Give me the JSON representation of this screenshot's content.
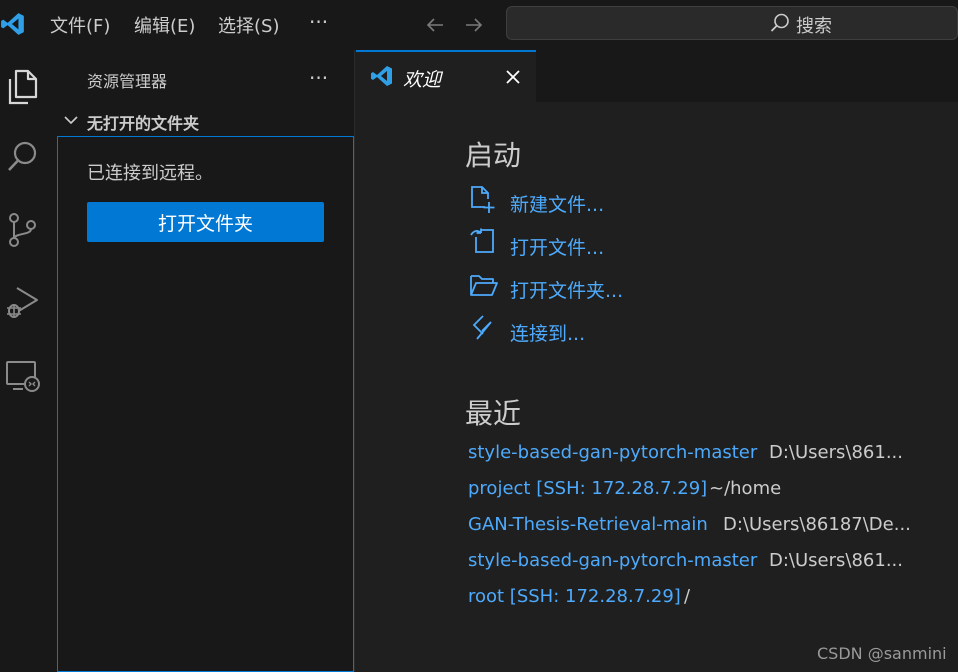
{
  "titlebar": {
    "menu": [
      {
        "label": "文件(F)"
      },
      {
        "label": "编辑(E)"
      },
      {
        "label": "选择(S)"
      }
    ],
    "more_label": "···",
    "search": {
      "label": "搜索"
    }
  },
  "sidebar": {
    "title": "资源管理器",
    "more_label": "···",
    "section_title": "无打开的文件夹",
    "message": "已连接到远程。",
    "open_folder_button": "打开文件夹"
  },
  "editor": {
    "tab": {
      "label": "欢迎"
    }
  },
  "welcome": {
    "start_title": "启动",
    "start_items": [
      {
        "label": "新建文件...",
        "icon": "new-file-icon"
      },
      {
        "label": "打开文件...",
        "icon": "open-file-icon"
      },
      {
        "label": "打开文件夹...",
        "icon": "open-folder-icon"
      },
      {
        "label": "连接到...",
        "icon": "remote-connect-icon"
      }
    ],
    "recent_title": "最近",
    "recent": [
      {
        "name": "style-based-gan-pytorch-master",
        "path": "D:\\Users\\861..."
      },
      {
        "name": "project [SSH: 172.28.7.29]",
        "path": "~/home"
      },
      {
        "name": "GAN-Thesis-Retrieval-main",
        "path": "D:\\Users\\86187\\De..."
      },
      {
        "name": "style-based-gan-pytorch-master",
        "path": "D:\\Users\\861..."
      },
      {
        "name": "root [SSH: 172.28.7.29]",
        "path": "/"
      }
    ]
  },
  "watermark": "CSDN @sanmini",
  "colors": {
    "accent": "#0078d4",
    "link": "#4daafc",
    "background": "#1f1f1f",
    "sidebar": "#181818"
  }
}
